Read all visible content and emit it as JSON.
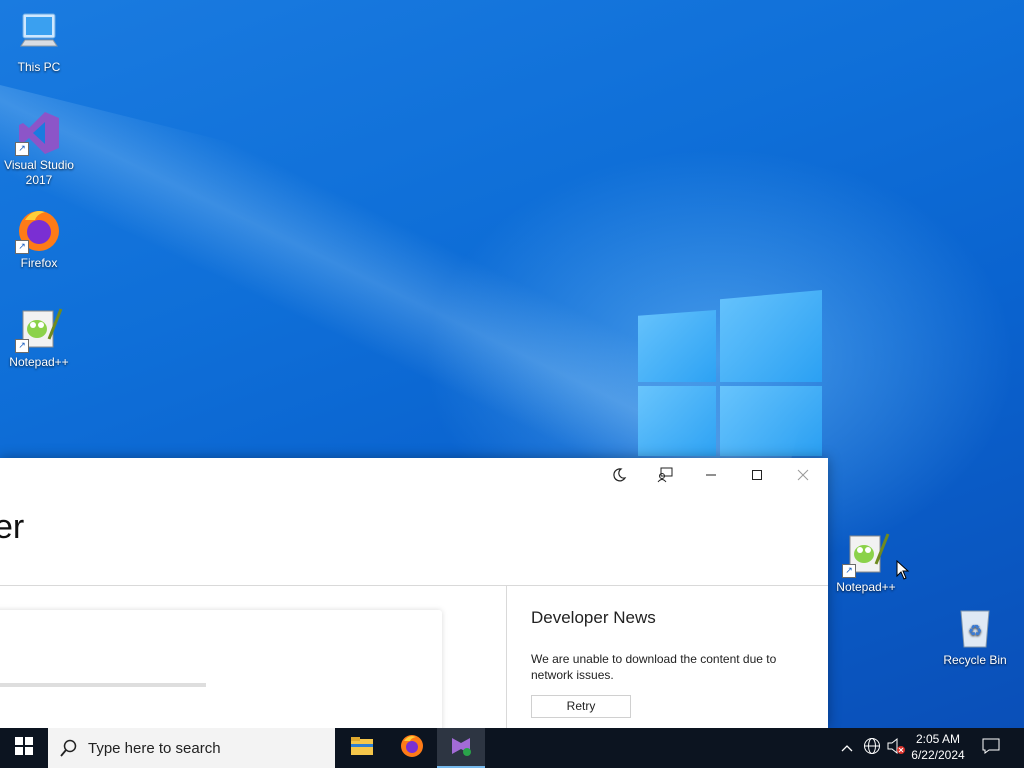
{
  "desktop": {
    "icons": [
      {
        "label": "This PC"
      },
      {
        "label": "Visual Studio 2017"
      },
      {
        "label": "Firefox"
      },
      {
        "label": "Notepad++"
      },
      {
        "label": "Notepad++"
      },
      {
        "label": "Recycle Bin"
      }
    ]
  },
  "app": {
    "title_fragment": "er",
    "titlebar": {
      "theme_icon": "moon-icon",
      "feedback_icon": "feedback-icon",
      "minimize_icon": "minimize-icon",
      "maximize_icon": "maximize-icon",
      "close_icon": "close-icon"
    },
    "news": {
      "title": "Developer News",
      "message": "We are unable to download the content due to network issues.",
      "retry_label": "Retry"
    }
  },
  "taskbar": {
    "search_placeholder": "Type here to search",
    "pinned": [
      "file-explorer-icon",
      "firefox-icon",
      "visual-studio-installer-icon"
    ],
    "clock": {
      "time": "2:05 AM",
      "date": "6/22/2024"
    },
    "accent": "#76b9ed"
  },
  "colors": {
    "desktop_bg": "#0f6fd8",
    "taskbar_bg": "#0c1420",
    "window_bg": "#ffffff"
  }
}
